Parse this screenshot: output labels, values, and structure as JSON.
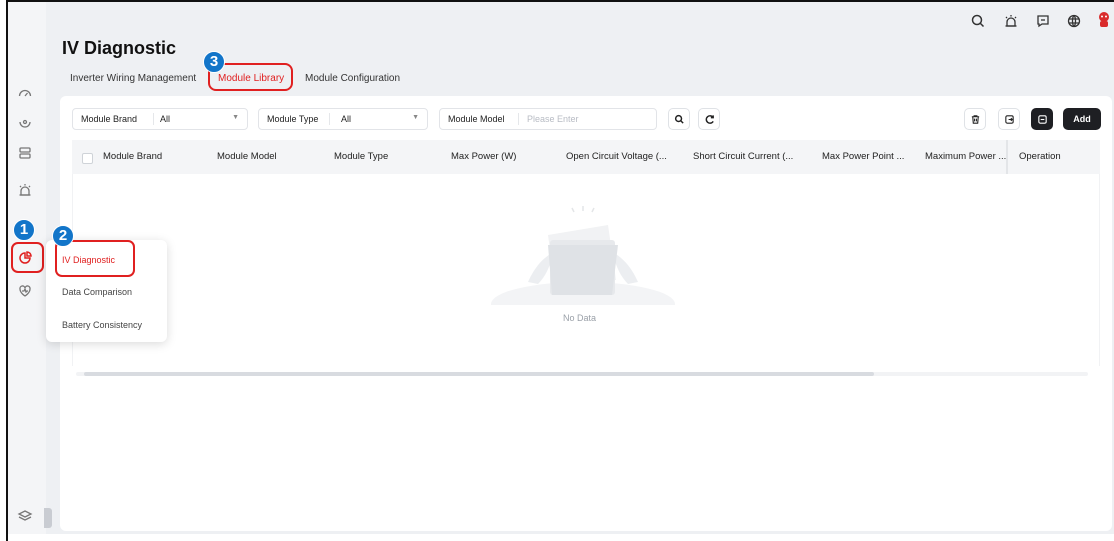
{
  "page": {
    "title": "IV Diagnostic"
  },
  "tabs": [
    {
      "label": "Inverter Wiring Management",
      "active": false
    },
    {
      "label": "Module Library",
      "active": true
    },
    {
      "label": "Module Configuration",
      "active": false
    }
  ],
  "filters": {
    "brand": {
      "label": "Module Brand",
      "value": "All"
    },
    "type": {
      "label": "Module Type",
      "value": "All"
    },
    "model": {
      "label": "Module Model",
      "placeholder": "Please Enter"
    }
  },
  "toolbar": {
    "add_label": "Add"
  },
  "table": {
    "columns": [
      "Module Brand",
      "Module Model",
      "Module Type",
      "Max Power (W)",
      "Open Circuit Voltage (...",
      "Short Circuit Current (...",
      "Max Power Point ...",
      "Maximum Power ...",
      "Operation"
    ],
    "empty_text": "No Data"
  },
  "menu": {
    "items": [
      {
        "label": "IV Diagnostic",
        "active": true
      },
      {
        "label": "Data Comparison",
        "active": false
      },
      {
        "label": "Battery Consistency",
        "active": false
      }
    ]
  },
  "annotations": {
    "step1": "1",
    "step2": "2",
    "step3": "3"
  },
  "colors": {
    "accent": "#e02020",
    "badge": "#1275c9",
    "dark_button": "#1e1f23"
  }
}
